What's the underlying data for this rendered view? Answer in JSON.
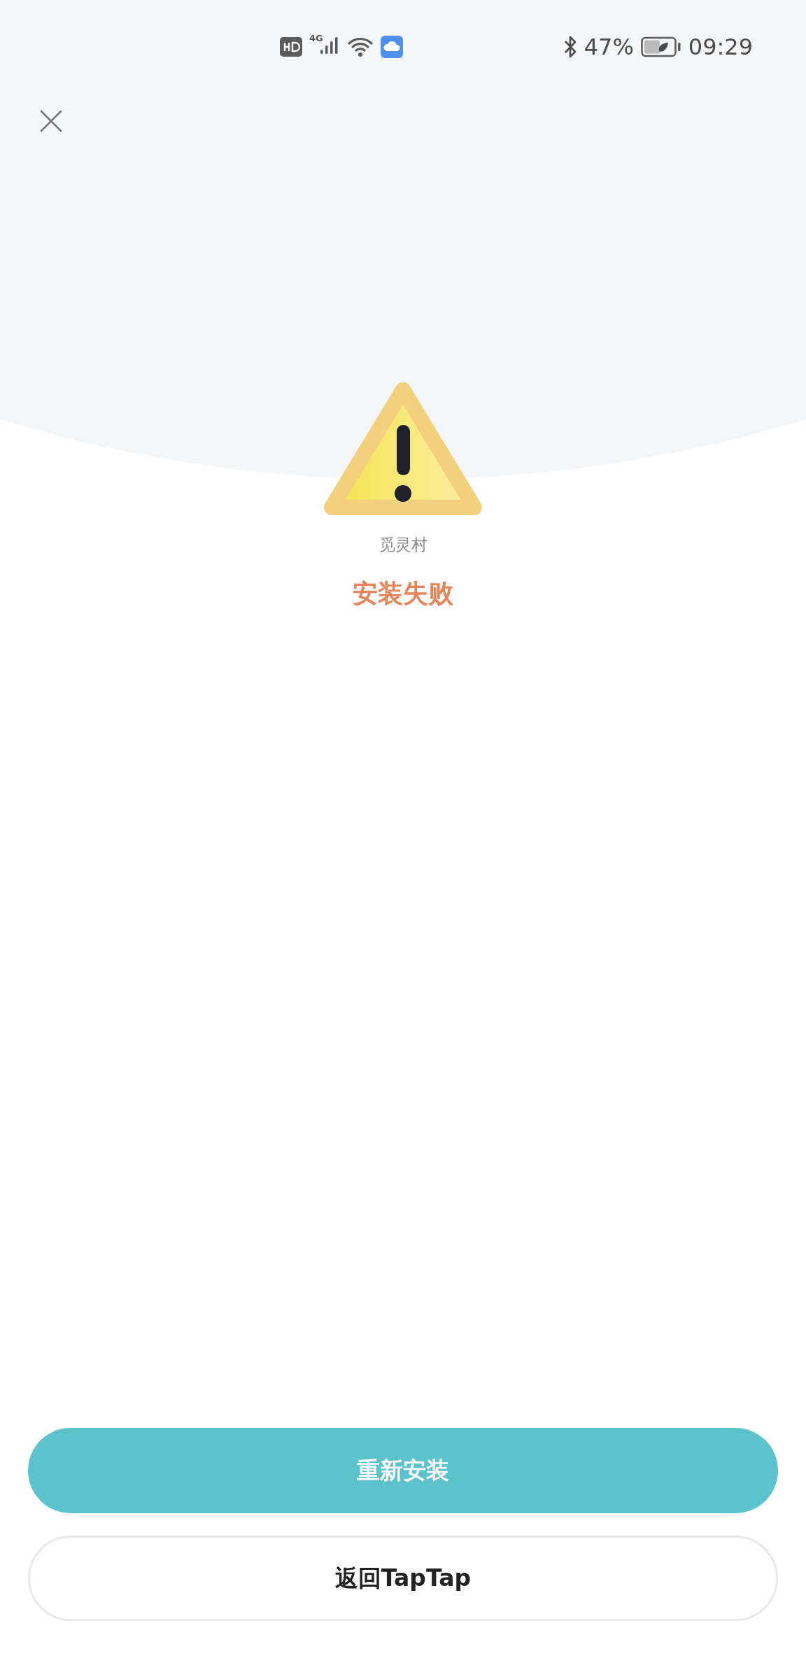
{
  "status_bar": {
    "network": "4G",
    "battery": "47%",
    "time": "09:29"
  },
  "app_name": "觅灵村",
  "status": "安装失败",
  "buttons": [
    {
      "label": "重新安装",
      "kind": "primary"
    },
    {
      "label": "返回TapTap",
      "kind": "secondary"
    }
  ]
}
